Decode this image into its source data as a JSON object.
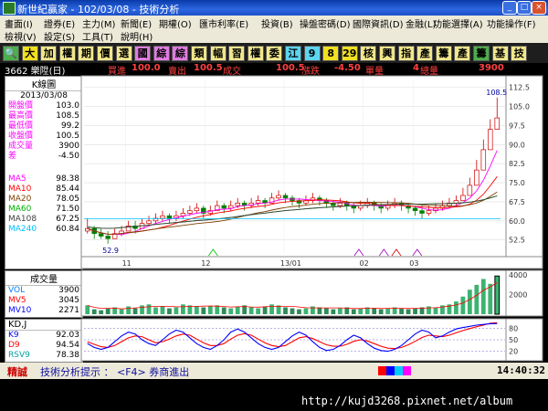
{
  "window": {
    "title": "新世紀贏家 - 102/03/08 - 技術分析"
  },
  "menu": {
    "row1": [
      "畫面(I)",
      "證券(E)",
      "主力(M)",
      "新聞(E)",
      "期權(O)",
      "匯市利率(E)",
      "投資(B)",
      "操盤密碼(D)",
      "國際資訊(D)",
      "金融(L)",
      "功能選擇(A)",
      "功能操作(F)"
    ],
    "row2": [
      "檢視(V)",
      "設定(S)",
      "工具(T)",
      "說明(H)"
    ]
  },
  "toolbar": {
    "buttons": [
      {
        "icon": "search-icon",
        "glyph": "🔍",
        "bg": "#4cae4c"
      },
      {
        "label": "大",
        "bg": "#f0e020"
      },
      {
        "label": "加",
        "bg": "#f0e68c"
      },
      {
        "label": "權",
        "bg": "#f0e68c"
      },
      {
        "label": "期",
        "bg": "#f0e68c"
      },
      {
        "label": "價",
        "bg": "#f0e68c"
      },
      {
        "label": "選",
        "bg": "#f0e68c"
      },
      {
        "label": "國",
        "bg": "#e07be0"
      },
      {
        "label": "綜",
        "bg": "#e07be0"
      },
      {
        "label": "綜",
        "bg": "#e07be0"
      },
      {
        "label": "類",
        "bg": "#f0e68c"
      },
      {
        "label": "幅",
        "bg": "#f0e68c"
      },
      {
        "label": "習",
        "bg": "#f0e68c"
      },
      {
        "label": "權",
        "bg": "#f0e68c"
      },
      {
        "label": "委",
        "bg": "#f0e68c"
      },
      {
        "label": "江",
        "bg": "#5dd5f0"
      },
      {
        "label": "9",
        "bg": "#5dd5f0"
      },
      {
        "label": "8",
        "bg": "#f0e020"
      },
      {
        "label": "29",
        "bg": "#f0e020"
      },
      {
        "label": "核",
        "bg": "#f0e68c"
      },
      {
        "label": "興",
        "bg": "#f0e68c"
      },
      {
        "label": "指",
        "bg": "#f0e68c"
      },
      {
        "label": "產",
        "bg": "#f0e68c"
      },
      {
        "label": "籌",
        "bg": "#f0e68c"
      },
      {
        "label": "產",
        "bg": "#f0e68c"
      },
      {
        "label": "籌",
        "bg": "#4cae4c"
      },
      {
        "label": "基",
        "bg": "#f0e68c"
      },
      {
        "label": "技",
        "bg": "#f0e68c"
      }
    ]
  },
  "infobar": {
    "stock": "3662 樂陞(日)",
    "bid_label": "買進",
    "bid": "100.0",
    "ask_label": "賣出",
    "ask": "100.5",
    "last_label": "成交",
    "last": "100.5",
    "chg_label": "漲跌",
    "chg": "-4.50",
    "vol_label": "單量",
    "vol": "4",
    "total_label": "總量",
    "total": "3900"
  },
  "kpanel": {
    "header": "K線圖",
    "date": "2013/03/08",
    "ohlc": [
      {
        "label": "開盤價",
        "value": "103.0"
      },
      {
        "label": "最高價",
        "value": "108.5"
      },
      {
        "label": "最低價",
        "value": "99.2"
      },
      {
        "label": "收盤價",
        "value": "100.5"
      },
      {
        "label": "成交量",
        "value": "3900"
      },
      {
        "label": "差",
        "value": "-4.50"
      }
    ],
    "ma": [
      {
        "label": "MA5",
        "value": "98.38",
        "color": "#ff00ff"
      },
      {
        "label": "MA10",
        "value": "85.44",
        "color": "#ff0000"
      },
      {
        "label": "MA20",
        "value": "78.05",
        "color": "#804000"
      },
      {
        "label": "MA60",
        "value": "71.50",
        "color": "#00b000"
      },
      {
        "label": "MA108",
        "value": "67.25",
        "color": "#404040"
      },
      {
        "label": "MA240",
        "value": "60.84",
        "color": "#00c0ff"
      }
    ]
  },
  "volpanel": {
    "header": "成交量",
    "rows": [
      {
        "label": "VOL",
        "value": "3900",
        "color": "#0080ff"
      },
      {
        "label": "MV5",
        "value": "3045",
        "color": "#ff0000"
      },
      {
        "label": "MV10",
        "value": "2271",
        "color": "#0000ff"
      }
    ]
  },
  "kdpanel": {
    "header": "KD,J",
    "rows": [
      {
        "label": "K9",
        "value": "92.03",
        "color": "#0000ff"
      },
      {
        "label": "D9",
        "value": "94.54",
        "color": "#ff0000"
      },
      {
        "label": "RSV9",
        "value": "78.38",
        "color": "#00a0a0"
      }
    ]
  },
  "chart_data": {
    "type": "candlestick",
    "y_axis_main": [
      "112.5",
      "105.0",
      "97.5",
      "90.0",
      "82.5",
      "75.0",
      "67.5",
      "60.0",
      "52.5"
    ],
    "ylim_main": [
      47,
      116
    ],
    "x_labels": [
      "11",
      "12",
      "13/01",
      "02",
      "03"
    ],
    "annotations": {
      "high_label": "108.5",
      "low_label": "52.9"
    },
    "y_axis_vol": [
      "4000",
      "2000"
    ],
    "ylim_vol": [
      0,
      4200
    ],
    "y_axis_kd": [
      "80",
      "50",
      "20"
    ],
    "ylim_kd": [
      0,
      100
    ],
    "candle_closes": [
      57,
      55,
      54,
      53,
      55,
      56,
      58,
      57,
      59,
      60,
      61,
      62,
      61,
      62,
      63,
      64,
      65,
      63,
      64,
      66,
      65,
      66,
      67,
      66,
      67,
      68,
      67,
      69,
      70,
      69,
      68,
      67,
      68,
      69,
      68,
      67,
      66,
      67,
      66,
      65,
      66,
      67,
      66,
      65,
      66,
      67,
      66,
      65,
      64,
      63,
      64,
      65,
      66,
      67,
      68,
      70,
      74,
      80,
      88,
      96,
      100.5
    ],
    "candle_highs": [
      61,
      58,
      57,
      56,
      57,
      58,
      60,
      60,
      61,
      62,
      63,
      64,
      63,
      64,
      65,
      66,
      67,
      66,
      66,
      68,
      67,
      68,
      69,
      68,
      69,
      70,
      69,
      71,
      72,
      71,
      70,
      69,
      70,
      71,
      70,
      69,
      68,
      69,
      68,
      67,
      68,
      69,
      68,
      67,
      68,
      69,
      68,
      67,
      66,
      66,
      66,
      67,
      68,
      69,
      70,
      73,
      77,
      84,
      92,
      100,
      108.5
    ],
    "candle_lows": [
      55,
      52.9,
      52.9,
      51,
      53,
      54,
      56,
      55,
      57,
      58,
      59,
      60,
      59,
      60,
      61,
      62,
      63,
      61,
      62,
      64,
      63,
      64,
      65,
      64,
      65,
      66,
      65,
      67,
      68,
      67,
      66,
      65,
      66,
      67,
      66,
      65,
      64,
      65,
      64,
      63,
      64,
      65,
      64,
      63,
      64,
      65,
      64,
      63,
      62,
      61,
      62,
      63,
      64,
      65,
      66,
      68,
      72,
      78,
      86,
      94,
      99.2
    ],
    "volumes": [
      900,
      500,
      400,
      600,
      700,
      500,
      800,
      600,
      900,
      1000,
      700,
      800,
      600,
      700,
      1000,
      900,
      800,
      700,
      800,
      900,
      700,
      600,
      800,
      900,
      700,
      600,
      800,
      1000,
      900,
      700,
      600,
      500,
      600,
      800,
      700,
      600,
      500,
      600,
      700,
      500,
      600,
      700,
      600,
      500,
      600,
      700,
      600,
      500,
      600,
      700,
      800,
      700,
      900,
      1000,
      1300,
      1800,
      2500,
      3000,
      3600,
      3100,
      3900
    ],
    "k_values": [
      40,
      30,
      25,
      30,
      45,
      60,
      70,
      65,
      50,
      40,
      35,
      50,
      65,
      75,
      70,
      55,
      40,
      30,
      25,
      35,
      50,
      70,
      78,
      70,
      55,
      40,
      30,
      25,
      30,
      45,
      60,
      70,
      62,
      45,
      30,
      22,
      25,
      35,
      50,
      62,
      55,
      40,
      28,
      22,
      20,
      25,
      35,
      50,
      65,
      75,
      70,
      55,
      60,
      70,
      78,
      82,
      85,
      88,
      90,
      92,
      92.03
    ],
    "d_values": [
      45,
      38,
      32,
      30,
      35,
      45,
      55,
      60,
      58,
      50,
      42,
      45,
      52,
      60,
      65,
      62,
      52,
      42,
      35,
      35,
      40,
      52,
      62,
      66,
      62,
      52,
      42,
      35,
      32,
      35,
      45,
      55,
      58,
      53,
      45,
      37,
      33,
      33,
      38,
      46,
      50,
      47,
      40,
      33,
      28,
      27,
      30,
      37,
      46,
      56,
      62,
      60,
      58,
      62,
      68,
      74,
      79,
      84,
      88,
      93,
      94.54
    ]
  },
  "status": {
    "left": "精誠",
    "tip": "技術分析提示 ： <F4> 券商進出",
    "time": "14:40:32"
  },
  "watermark": {
    "url": "http://kujd3268.pixnet.net/album"
  }
}
